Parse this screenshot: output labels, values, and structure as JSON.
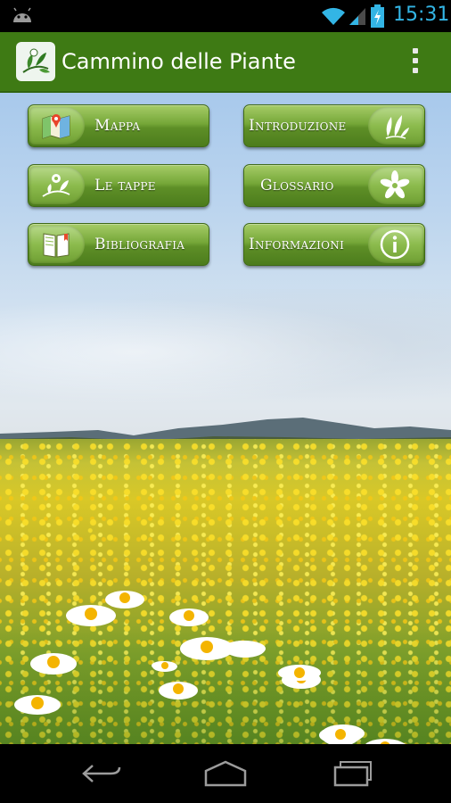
{
  "status_bar": {
    "time": "15:31",
    "icons": [
      "android-notification-icon",
      "wifi-icon",
      "cell-signal-icon",
      "battery-charging-icon"
    ]
  },
  "action_bar": {
    "title": "Cammino delle Piante",
    "app_icon": "plant-logo-icon",
    "overflow_icon": "overflow-menu-icon"
  },
  "menu": {
    "buttons": [
      {
        "label": "Mappa",
        "icon": "map-icon"
      },
      {
        "label": "Introduzione",
        "icon": "leaves-icon"
      },
      {
        "label": "Le tappe",
        "icon": "flower-branch-icon"
      },
      {
        "label": "Glossario",
        "icon": "jasmine-flower-icon"
      },
      {
        "label": "Bibliografia",
        "icon": "book-icon"
      },
      {
        "label": "Informazioni",
        "icon": "info-icon"
      }
    ]
  },
  "colors": {
    "action_bar": "#3e7a14",
    "button_green": "#5e8f27",
    "status_accent": "#33b5e5"
  },
  "nav_bar": {
    "icons": [
      "back-icon",
      "home-icon",
      "recent-apps-icon"
    ]
  }
}
